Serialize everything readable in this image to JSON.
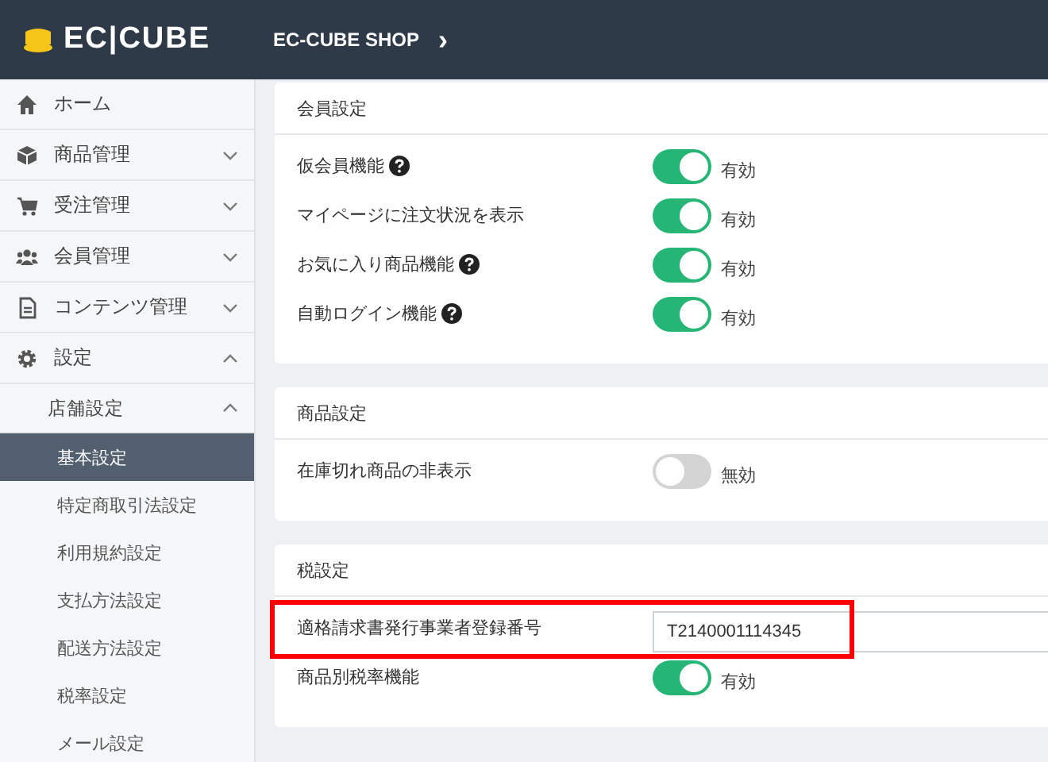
{
  "header": {
    "logo": "EC|CUBE",
    "shop": "EC-CUBE SHOP",
    "arrow": "›"
  },
  "sidebar": {
    "items": [
      {
        "label": "ホーム"
      },
      {
        "label": "商品管理",
        "expanded": false
      },
      {
        "label": "受注管理",
        "expanded": false
      },
      {
        "label": "会員管理",
        "expanded": false
      },
      {
        "label": "コンテンツ管理",
        "expanded": false
      },
      {
        "label": "設定",
        "expanded": true,
        "children": [
          {
            "label": "店舗設定",
            "expanded": true,
            "children": [
              {
                "label": "基本設定",
                "selected": true
              },
              {
                "label": "特定商取引法設定",
                "selected": false
              },
              {
                "label": "利用規約設定",
                "selected": false
              },
              {
                "label": "支払方法設定",
                "selected": false
              },
              {
                "label": "配送方法設定",
                "selected": false
              },
              {
                "label": "税率設定",
                "selected": false
              },
              {
                "label": "メール設定",
                "selected": false
              }
            ]
          }
        ]
      }
    ]
  },
  "sections": [
    {
      "title": "会員設定",
      "rows": [
        {
          "kind": "toggle",
          "label": "仮会員機能",
          "help": true,
          "on": true,
          "status": "有効",
          "highlighted": false
        },
        {
          "kind": "toggle",
          "label": "マイページに注文状況を表示",
          "help": false,
          "on": true,
          "status": "有効",
          "highlighted": false
        },
        {
          "kind": "toggle",
          "label": "お気に入り商品機能",
          "help": true,
          "on": true,
          "status": "有効",
          "highlighted": false
        },
        {
          "kind": "toggle",
          "label": "自動ログイン機能",
          "help": true,
          "on": true,
          "status": "有効",
          "highlighted": false
        }
      ]
    },
    {
      "title": "商品設定",
      "rows": [
        {
          "kind": "toggle",
          "label": "在庫切れ商品の非表示",
          "help": false,
          "on": false,
          "status": "無効",
          "highlighted": false
        }
      ]
    },
    {
      "title": "税設定",
      "rows": [
        {
          "kind": "text",
          "label": "適格請求書発行事業者登録番号",
          "help": false,
          "value": "T2140001114345",
          "highlighted": true
        },
        {
          "kind": "toggle",
          "label": "商品別税率機能",
          "help": false,
          "on": true,
          "status": "有効",
          "highlighted": false
        }
      ]
    }
  ]
}
